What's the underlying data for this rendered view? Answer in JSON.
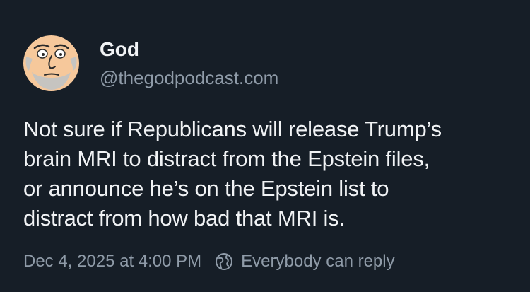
{
  "post": {
    "author": {
      "display_name": "God",
      "handle": "@thegodpodcast.com",
      "avatar_icon": "bald-bearded-man-avatar-icon"
    },
    "text_lines": [
      "Not sure if Republicans will release Trump’s",
      "brain MRI to distract from the Epstein files,",
      "or announce he’s on the Epstein list to",
      "distract from how bad that MRI is."
    ],
    "timestamp": "Dec 4, 2025 at 4:00 PM",
    "reply_setting": {
      "icon": "globe-icon",
      "label": "Everybody can reply"
    }
  },
  "colors": {
    "background": "#161e27",
    "primary_text": "#f1f3f5",
    "secondary_text": "#8f9ba8",
    "avatar_skin": "#f6c89b"
  }
}
